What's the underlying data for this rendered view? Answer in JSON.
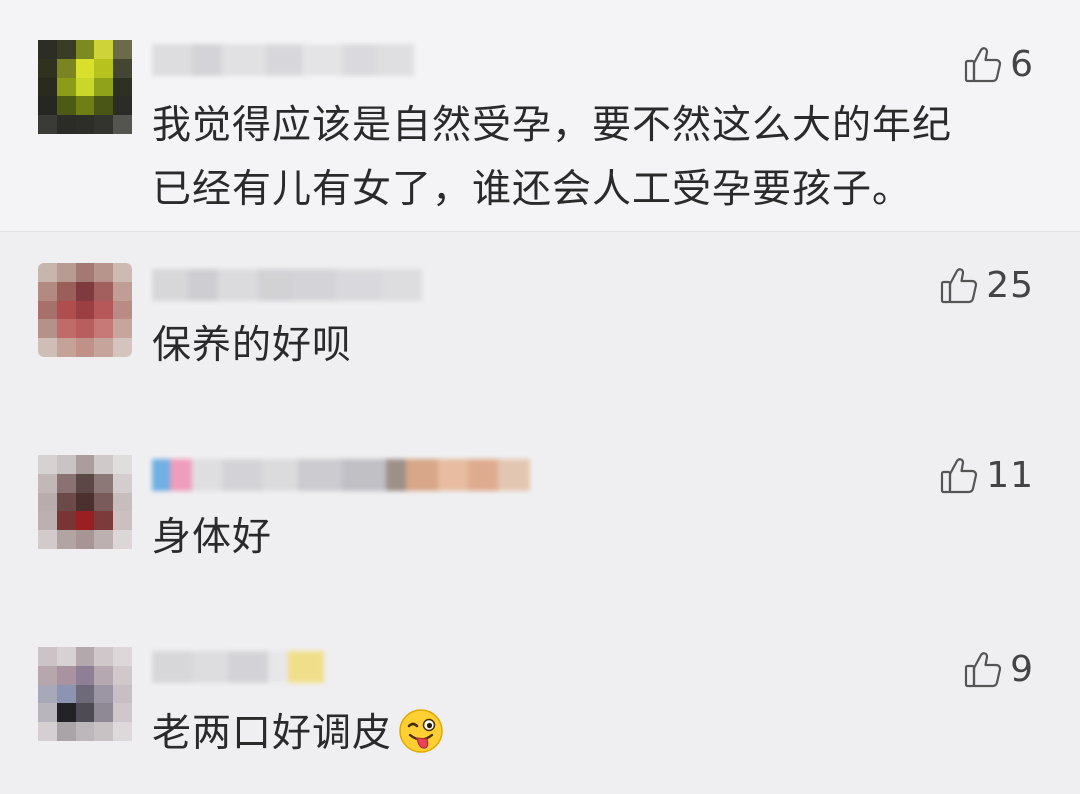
{
  "comments": [
    {
      "nickname": "",
      "likes": "6",
      "text_lines": [
        "我觉得应该是自然受孕，要不然这么大的年纪",
        "已经有儿有女了，谁还会人工受孕要孩子。"
      ],
      "emoji": null
    },
    {
      "nickname": "",
      "likes": "25",
      "text_lines": [
        "保养的好呗"
      ],
      "emoji": null
    },
    {
      "nickname": "",
      "likes": "11",
      "text_lines": [
        "身体好"
      ],
      "emoji": null
    },
    {
      "nickname": "",
      "likes": "9",
      "text_lines": [
        "老两口好调皮"
      ],
      "emoji": "winking-tongue-face"
    }
  ],
  "icons": {
    "like": "thumbs-up-icon"
  }
}
